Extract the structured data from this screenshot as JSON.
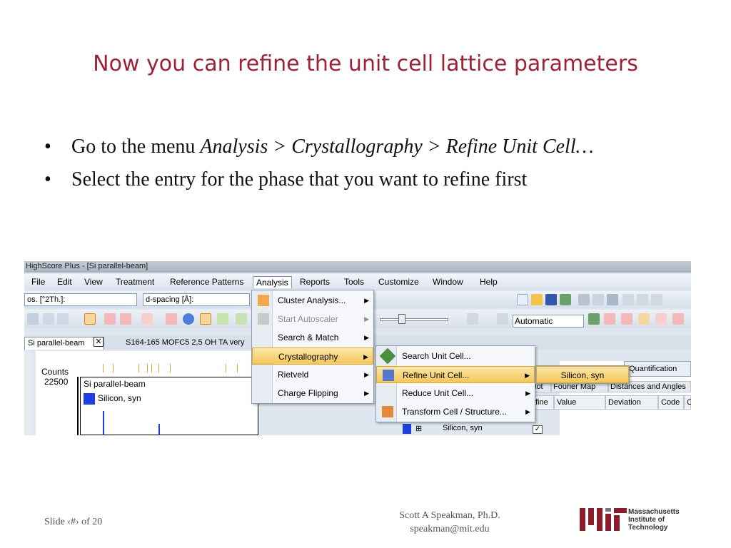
{
  "slide": {
    "title": "Now you can refine the unit cell lattice parameters",
    "bullet1_pre": "Go to the menu ",
    "bullet1_em": "Analysis > Crystallography > Refine Unit Cell…",
    "bullet2": "Select the entry for the phase that you want to refine first",
    "footer_left": "Slide ‹#› of 20",
    "footer_author": "Scott A Speakman, Ph.D.",
    "footer_email": "speakman@mit.edu",
    "logo_line1": "Massachusetts",
    "logo_line2": "Institute of",
    "logo_line3": "Technology"
  },
  "app": {
    "window_title": "HighScore Plus - [Si parallel-beam]",
    "menu": [
      "File",
      "Edit",
      "View",
      "Treatment",
      "Reference Patterns",
      "Analysis",
      "Reports",
      "Tools",
      "Customize",
      "Window",
      "Help"
    ],
    "field_pos": "os. [°2Th.]:",
    "field_dspacing": "d-spacing [Å]:",
    "auto_select": "Automatic",
    "tab1": "Si parallel-beam",
    "tab2": "S164-165 MOFC5 2,5 OH TA very",
    "plot_counts": "Counts",
    "plot_value": "22500",
    "plot_legend_title": "Si parallel-beam",
    "plot_legend_entry": "Silicon, syn",
    "analysis_menu": [
      {
        "label": "Cluster Analysis...",
        "disabled": false
      },
      {
        "label": "Start Autoscaler",
        "disabled": true
      },
      {
        "label": "Search & Match",
        "disabled": false
      },
      {
        "label": "Crystallography",
        "disabled": false
      },
      {
        "label": "Rietveld",
        "disabled": false
      },
      {
        "label": "Charge Flipping",
        "disabled": false
      }
    ],
    "cryst_menu": [
      {
        "label": "Search Unit Cell..."
      },
      {
        "label": "Refine Unit Cell..."
      },
      {
        "label": "Reduce Unit Cell..."
      },
      {
        "label": "Transform Cell / Structure..."
      }
    ],
    "phase_menu": "Silicon, syn",
    "quant_tab": "Quantification",
    "subtabs": [
      "lot",
      "Fourier Map",
      "Distances and Angles"
    ],
    "col_headers": [
      "fine",
      "Value",
      "Deviation",
      "Code",
      "C"
    ],
    "grid_row": "Silicon, syn",
    "colors": {
      "title": "#9b2335",
      "highlight": "#f4c75a",
      "series": "#1d3fe0"
    }
  }
}
